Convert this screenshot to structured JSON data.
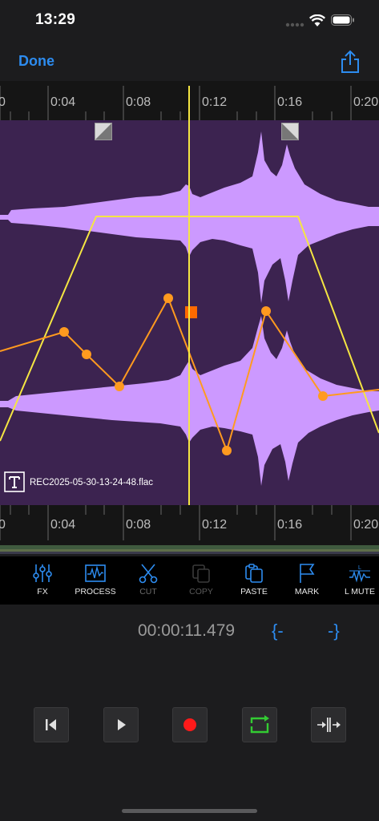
{
  "status_bar": {
    "time": "13:29"
  },
  "nav": {
    "done_label": "Done"
  },
  "ruler": {
    "labels": [
      "0",
      "0:04",
      "0:08",
      "0:12",
      "0:16",
      "0:20"
    ]
  },
  "waveform": {
    "filename": "REC2025-05-30-13-24-48.flac",
    "wave_color": "#cc99ff",
    "background": "#3c2350"
  },
  "envelopes": {
    "volume_color": "#f5e642",
    "pan_color": "#ff9a1f"
  },
  "toolbar": {
    "fx": "FX",
    "process": "PROCESS",
    "cut": "CUT",
    "copy": "COPY",
    "paste": "PASTE",
    "mark": "MARK",
    "l_mute": "L MUTE"
  },
  "playback": {
    "timecode": "00:00:11.479",
    "start_brace": "{-",
    "end_brace": "-}"
  },
  "colors": {
    "accent": "#2d8cf0",
    "record": "#ff1a1a",
    "loop": "#33cc33"
  }
}
